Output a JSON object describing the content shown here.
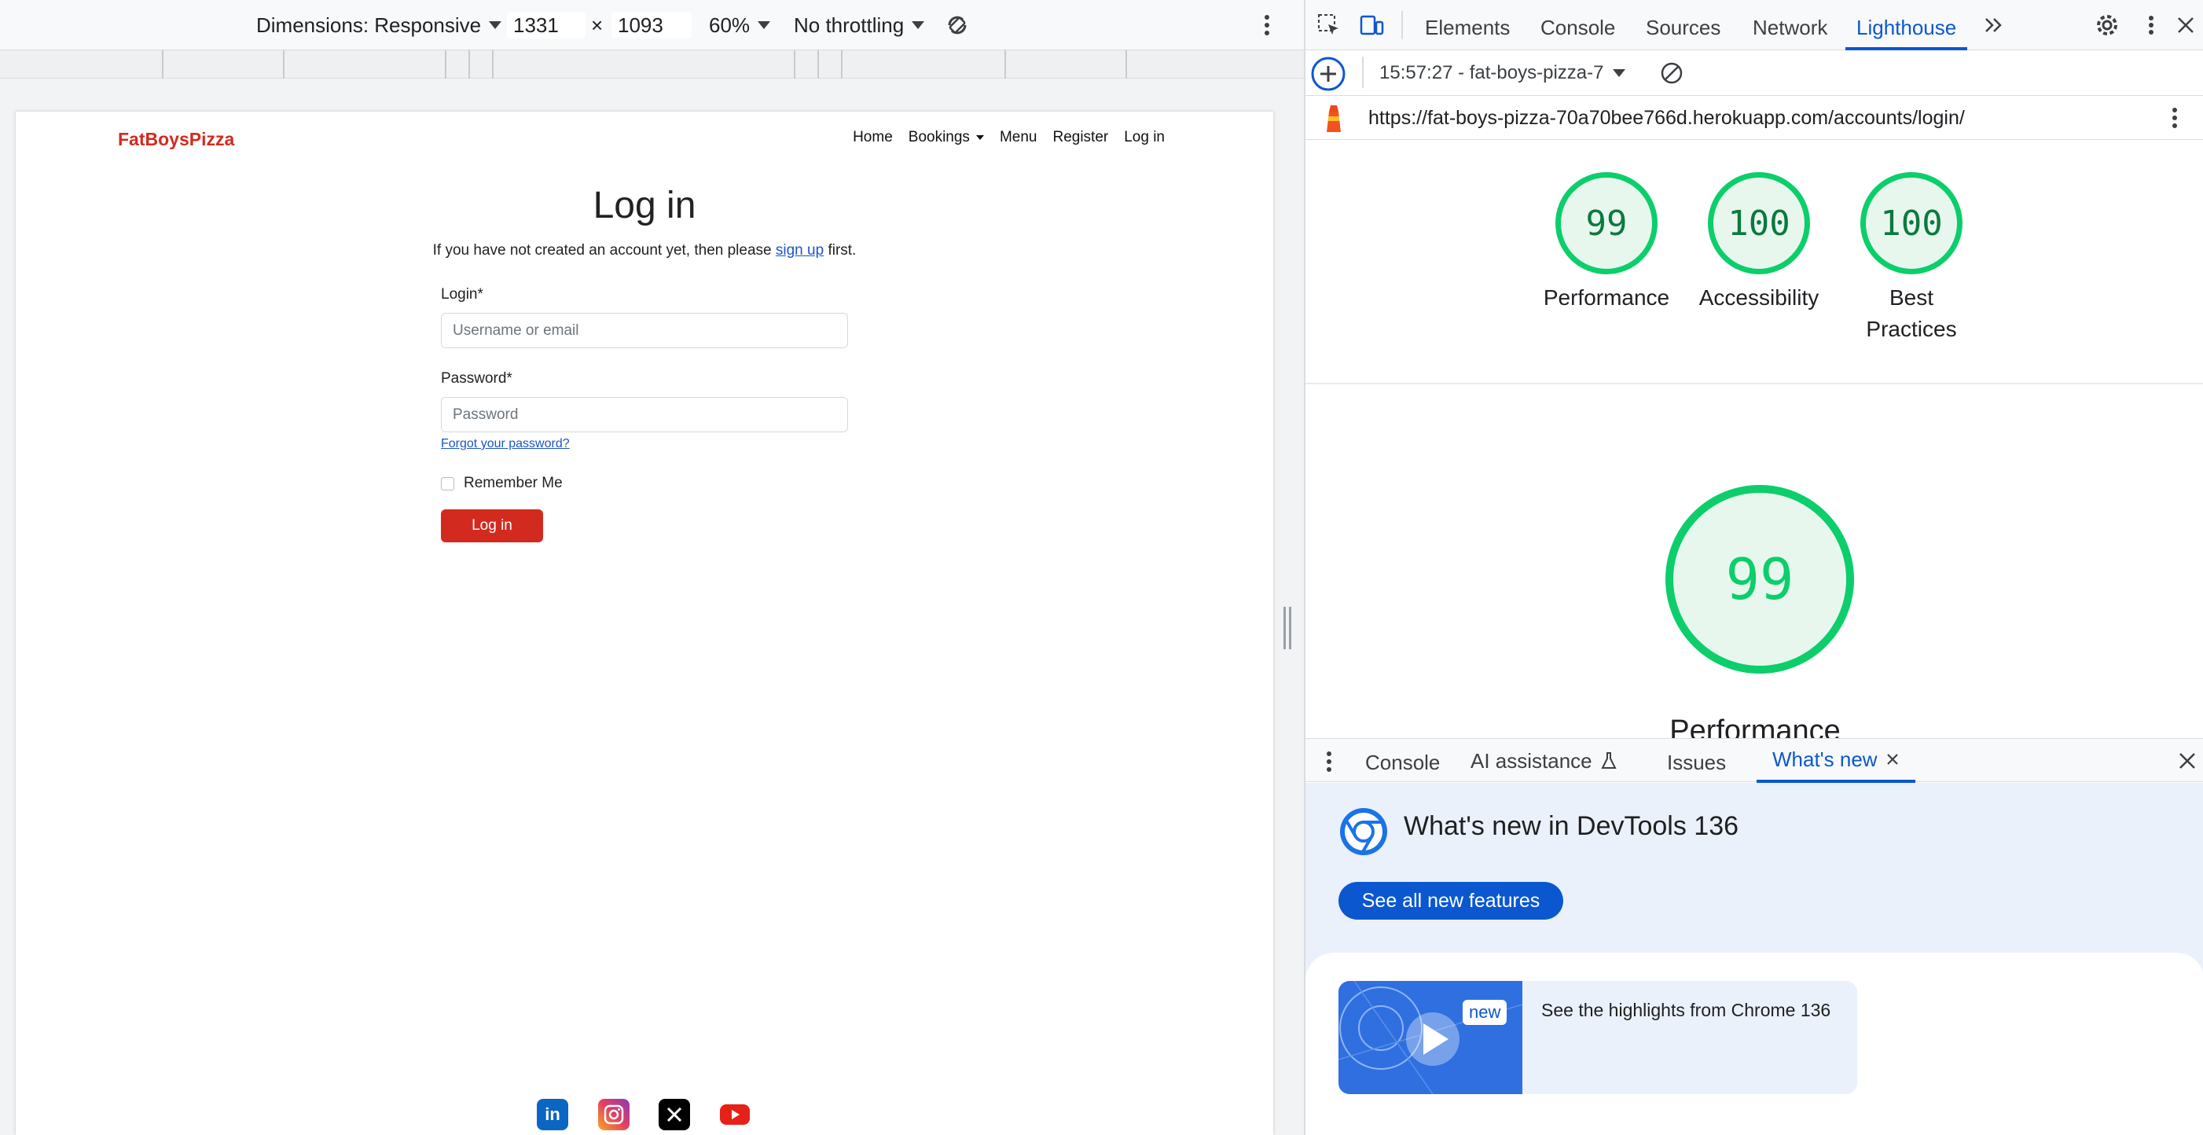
{
  "device_toolbar": {
    "dimensions_label": "Dimensions: Responsive",
    "width": "1331",
    "times": "×",
    "height": "1093",
    "zoom": "60%",
    "throttling": "No throttling"
  },
  "site": {
    "brand": "FatBoysPizza",
    "nav": {
      "home": "Home",
      "bookings": "Bookings",
      "menu": "Menu",
      "register": "Register",
      "login": "Log in"
    },
    "title": "Log in",
    "subtitle_before": "If you have not created an account yet, then please ",
    "subtitle_link": "sign up",
    "subtitle_after": " first.",
    "login_label": "Login*",
    "login_placeholder": "Username or email",
    "password_label": "Password*",
    "password_placeholder": "Password",
    "forgot": "Forgot your password?",
    "remember": "Remember Me",
    "submit": "Log in"
  },
  "devtools": {
    "tabs": {
      "elements": "Elements",
      "console": "Console",
      "sources": "Sources",
      "network": "Network",
      "lighthouse": "Lighthouse"
    },
    "report_select": "15:57:27 - fat-boys-pizza-7",
    "url": "https://fat-boys-pizza-70a70bee766d.herokuapp.com/accounts/login/",
    "scores": [
      {
        "value": "99",
        "label": "Performance"
      },
      {
        "value": "100",
        "label": "Accessibility"
      },
      {
        "value": "100",
        "label": "Best Practices"
      }
    ],
    "main_score": "99",
    "main_label": "Performance",
    "drawer": {
      "console": "Console",
      "ai": "AI assistance",
      "issues": "Issues",
      "whatsnew": "What's new"
    },
    "whatsnew_title": "What's new in DevTools 136",
    "whatsnew_button": "See all new features",
    "card_badge": "new",
    "card_text": "See the highlights from Chrome 136"
  },
  "colors": {
    "brand": "#d32a1f",
    "accent": "#0b57d0",
    "score_green": "#0cce6b"
  }
}
